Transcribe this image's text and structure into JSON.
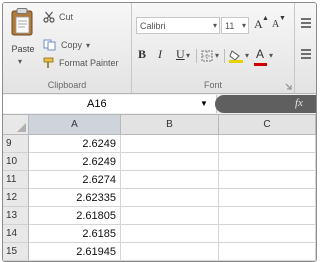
{
  "ribbon": {
    "clipboard": {
      "paste_label": "Paste",
      "cut_label": "Cut",
      "copy_label": "Copy",
      "format_painter_label": "Format Painter",
      "group_label": "Clipboard"
    },
    "font": {
      "font_name": "Calibri",
      "font_size": "11",
      "bold_label": "B",
      "italic_label": "I",
      "underline_label": "U",
      "grow_label": "A",
      "shrink_label": "A",
      "font_color_label": "A",
      "group_label": "Font"
    }
  },
  "formula_bar": {
    "name_box": "A16",
    "fx_label": "fx"
  },
  "grid": {
    "columns": [
      "A",
      "B",
      "C"
    ],
    "rows": [
      {
        "num": "9",
        "a": "2.6249"
      },
      {
        "num": "10",
        "a": "2.6249"
      },
      {
        "num": "11",
        "a": "2.6274"
      },
      {
        "num": "12",
        "a": "2.62335"
      },
      {
        "num": "13",
        "a": "2.61805"
      },
      {
        "num": "14",
        "a": "2.6185"
      },
      {
        "num": "15",
        "a": "2.61945"
      }
    ]
  }
}
